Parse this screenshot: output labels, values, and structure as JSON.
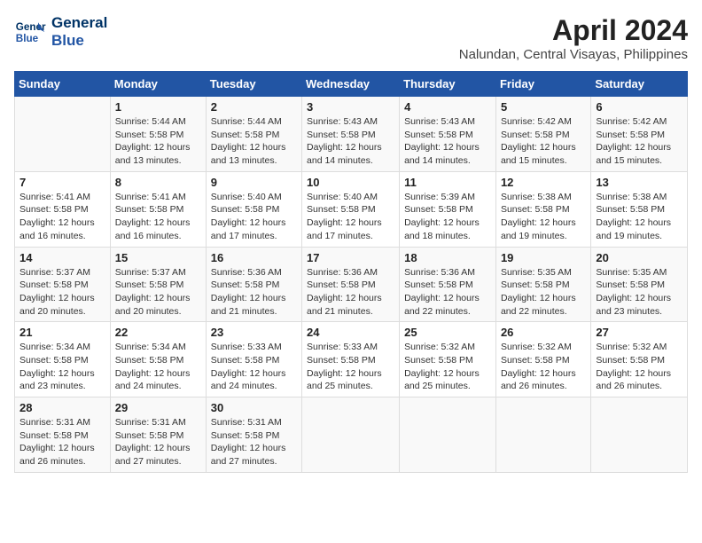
{
  "logo": {
    "line1": "General",
    "line2": "Blue"
  },
  "title": "April 2024",
  "location": "Nalundan, Central Visayas, Philippines",
  "days_header": [
    "Sunday",
    "Monday",
    "Tuesday",
    "Wednesday",
    "Thursday",
    "Friday",
    "Saturday"
  ],
  "weeks": [
    [
      {
        "day": "",
        "text": ""
      },
      {
        "day": "1",
        "text": "Sunrise: 5:44 AM\nSunset: 5:58 PM\nDaylight: 12 hours\nand 13 minutes."
      },
      {
        "day": "2",
        "text": "Sunrise: 5:44 AM\nSunset: 5:58 PM\nDaylight: 12 hours\nand 13 minutes."
      },
      {
        "day": "3",
        "text": "Sunrise: 5:43 AM\nSunset: 5:58 PM\nDaylight: 12 hours\nand 14 minutes."
      },
      {
        "day": "4",
        "text": "Sunrise: 5:43 AM\nSunset: 5:58 PM\nDaylight: 12 hours\nand 14 minutes."
      },
      {
        "day": "5",
        "text": "Sunrise: 5:42 AM\nSunset: 5:58 PM\nDaylight: 12 hours\nand 15 minutes."
      },
      {
        "day": "6",
        "text": "Sunrise: 5:42 AM\nSunset: 5:58 PM\nDaylight: 12 hours\nand 15 minutes."
      }
    ],
    [
      {
        "day": "7",
        "text": "Sunrise: 5:41 AM\nSunset: 5:58 PM\nDaylight: 12 hours\nand 16 minutes."
      },
      {
        "day": "8",
        "text": "Sunrise: 5:41 AM\nSunset: 5:58 PM\nDaylight: 12 hours\nand 16 minutes."
      },
      {
        "day": "9",
        "text": "Sunrise: 5:40 AM\nSunset: 5:58 PM\nDaylight: 12 hours\nand 17 minutes."
      },
      {
        "day": "10",
        "text": "Sunrise: 5:40 AM\nSunset: 5:58 PM\nDaylight: 12 hours\nand 17 minutes."
      },
      {
        "day": "11",
        "text": "Sunrise: 5:39 AM\nSunset: 5:58 PM\nDaylight: 12 hours\nand 18 minutes."
      },
      {
        "day": "12",
        "text": "Sunrise: 5:38 AM\nSunset: 5:58 PM\nDaylight: 12 hours\nand 19 minutes."
      },
      {
        "day": "13",
        "text": "Sunrise: 5:38 AM\nSunset: 5:58 PM\nDaylight: 12 hours\nand 19 minutes."
      }
    ],
    [
      {
        "day": "14",
        "text": "Sunrise: 5:37 AM\nSunset: 5:58 PM\nDaylight: 12 hours\nand 20 minutes."
      },
      {
        "day": "15",
        "text": "Sunrise: 5:37 AM\nSunset: 5:58 PM\nDaylight: 12 hours\nand 20 minutes."
      },
      {
        "day": "16",
        "text": "Sunrise: 5:36 AM\nSunset: 5:58 PM\nDaylight: 12 hours\nand 21 minutes."
      },
      {
        "day": "17",
        "text": "Sunrise: 5:36 AM\nSunset: 5:58 PM\nDaylight: 12 hours\nand 21 minutes."
      },
      {
        "day": "18",
        "text": "Sunrise: 5:36 AM\nSunset: 5:58 PM\nDaylight: 12 hours\nand 22 minutes."
      },
      {
        "day": "19",
        "text": "Sunrise: 5:35 AM\nSunset: 5:58 PM\nDaylight: 12 hours\nand 22 minutes."
      },
      {
        "day": "20",
        "text": "Sunrise: 5:35 AM\nSunset: 5:58 PM\nDaylight: 12 hours\nand 23 minutes."
      }
    ],
    [
      {
        "day": "21",
        "text": "Sunrise: 5:34 AM\nSunset: 5:58 PM\nDaylight: 12 hours\nand 23 minutes."
      },
      {
        "day": "22",
        "text": "Sunrise: 5:34 AM\nSunset: 5:58 PM\nDaylight: 12 hours\nand 24 minutes."
      },
      {
        "day": "23",
        "text": "Sunrise: 5:33 AM\nSunset: 5:58 PM\nDaylight: 12 hours\nand 24 minutes."
      },
      {
        "day": "24",
        "text": "Sunrise: 5:33 AM\nSunset: 5:58 PM\nDaylight: 12 hours\nand 25 minutes."
      },
      {
        "day": "25",
        "text": "Sunrise: 5:32 AM\nSunset: 5:58 PM\nDaylight: 12 hours\nand 25 minutes."
      },
      {
        "day": "26",
        "text": "Sunrise: 5:32 AM\nSunset: 5:58 PM\nDaylight: 12 hours\nand 26 minutes."
      },
      {
        "day": "27",
        "text": "Sunrise: 5:32 AM\nSunset: 5:58 PM\nDaylight: 12 hours\nand 26 minutes."
      }
    ],
    [
      {
        "day": "28",
        "text": "Sunrise: 5:31 AM\nSunset: 5:58 PM\nDaylight: 12 hours\nand 26 minutes."
      },
      {
        "day": "29",
        "text": "Sunrise: 5:31 AM\nSunset: 5:58 PM\nDaylight: 12 hours\nand 27 minutes."
      },
      {
        "day": "30",
        "text": "Sunrise: 5:31 AM\nSunset: 5:58 PM\nDaylight: 12 hours\nand 27 minutes."
      },
      {
        "day": "",
        "text": ""
      },
      {
        "day": "",
        "text": ""
      },
      {
        "day": "",
        "text": ""
      },
      {
        "day": "",
        "text": ""
      }
    ]
  ]
}
